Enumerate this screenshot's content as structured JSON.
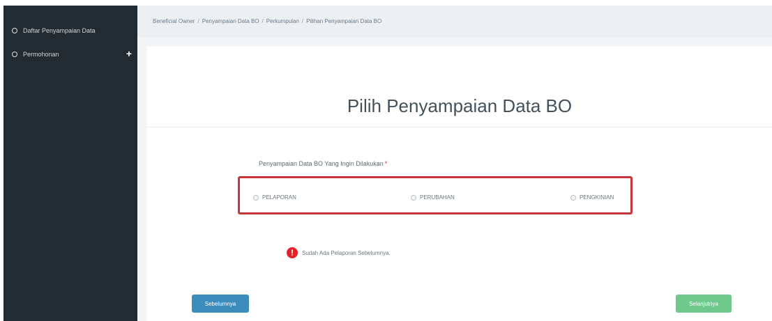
{
  "sidebar": {
    "items": [
      {
        "label": "Daftar Penyampaian Data",
        "icon": "circle-icon"
      },
      {
        "label": "Permohonan",
        "icon": "circle-icon",
        "expand_icon": "+"
      }
    ]
  },
  "breadcrumb": {
    "items": [
      "Beneficial Owner",
      "Penyampaian Data BO",
      "Perkumpulan",
      "Pilihan Penyampaian Data BO"
    ],
    "separator": "/"
  },
  "main": {
    "title": "Pilih Penyampaian Data BO",
    "field_label": "Penyampaian Data BO Yang Ingin Dilakukan",
    "required_mark": "*",
    "options": [
      "PELAPORAN",
      "PERUBAHAN",
      "PENGKINIAN"
    ],
    "alert_icon": "!",
    "alert_text": "Sudah Ada Pelaporan Sebelumnya.",
    "prev_button": "Sebelumnya",
    "next_button": "Selanjutnya"
  },
  "colors": {
    "sidebar_bg": "#222b31",
    "highlight_border": "#c9353a",
    "prev_button": "#3c8dbc",
    "next_button": "#6fc98c",
    "alert": "#e3222a"
  }
}
